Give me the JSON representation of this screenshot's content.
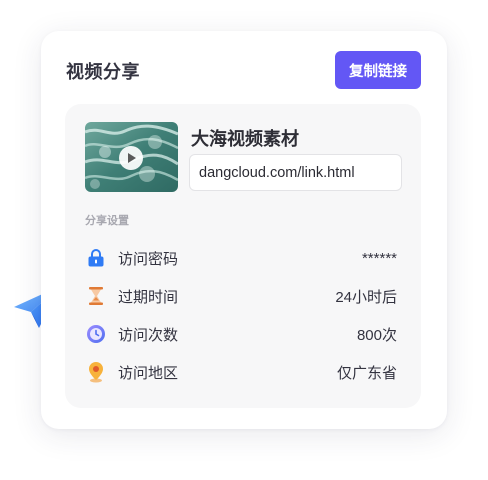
{
  "card": {
    "title": "视频分享",
    "copy_button": "复制链接"
  },
  "video": {
    "title": "大海视频素材",
    "link": "dangcloud.com/link.html"
  },
  "settings": {
    "section_label": "分享设置",
    "rows": [
      {
        "label": "访问密码",
        "value": "******",
        "icon": "lock-icon"
      },
      {
        "label": "过期时间",
        "value": "24小时后",
        "icon": "hourglass-icon"
      },
      {
        "label": "访问次数",
        "value": "800次",
        "icon": "clock-icon"
      },
      {
        "label": "访问地区",
        "value": "仅广东省",
        "icon": "location-pin-icon"
      }
    ]
  },
  "colors": {
    "accent": "#6357f5",
    "card_bg": "#ffffff",
    "inner_bg": "#f7f7f8",
    "plane": "#2f7bf5"
  }
}
